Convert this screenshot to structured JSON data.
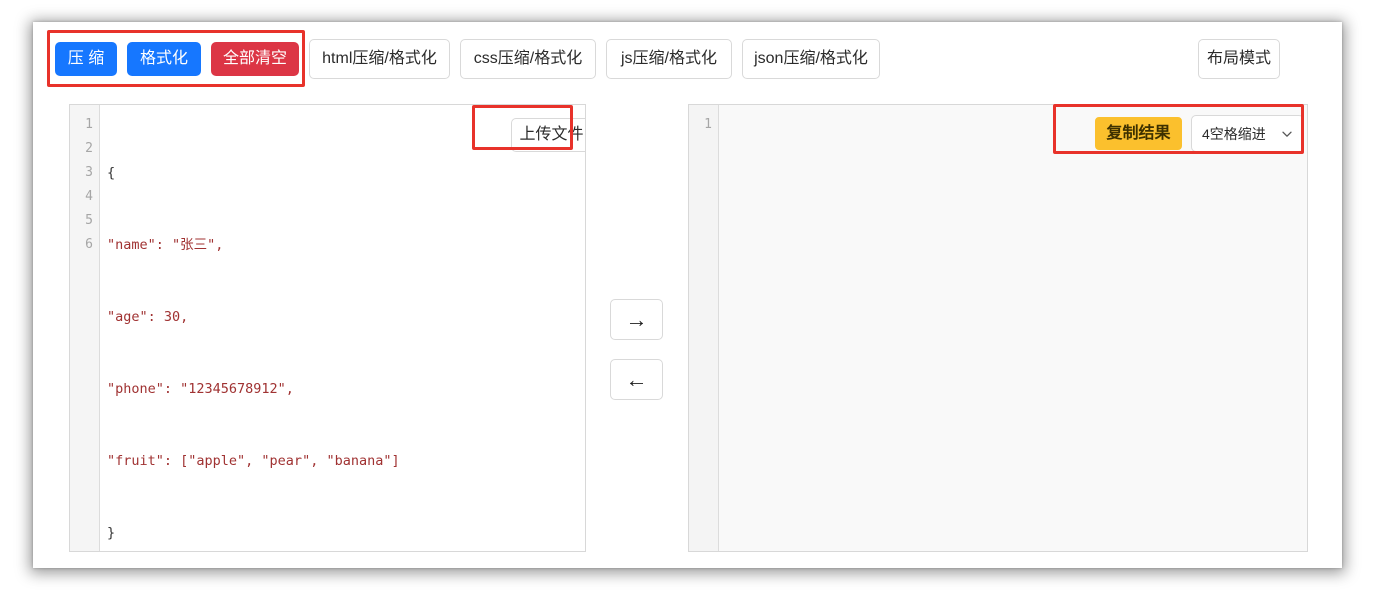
{
  "toolbar": {
    "actions": [
      {
        "label": "压 缩",
        "name": "compress-button",
        "style": "primary"
      },
      {
        "label": "格式化",
        "name": "format-button",
        "style": "primary"
      },
      {
        "label": "全部清空",
        "name": "clear-all-button",
        "style": "danger"
      }
    ],
    "tabs": [
      {
        "label": "html压缩/格式化",
        "name": "tab-html"
      },
      {
        "label": "css压缩/格式化",
        "name": "tab-css"
      },
      {
        "label": "js压缩/格式化",
        "name": "tab-js"
      },
      {
        "label": "json压缩/格式化",
        "name": "tab-json"
      }
    ],
    "layout_mode_label": "布局模式"
  },
  "left_editor": {
    "upload_label": "上传文件",
    "line_numbers": [
      "1",
      "2",
      "3",
      "4",
      "5",
      "6"
    ],
    "lines": [
      "{",
      "\"name\": \"张三\",",
      "\"age\": 30,",
      "\"phone\": \"12345678912\",",
      "\"fruit\": [\"apple\", \"pear\", \"banana\"]",
      "}"
    ]
  },
  "right_editor": {
    "copy_label": "复制结果",
    "indent_value": "4空格缩进",
    "chevron_icon": "chevron-down-icon",
    "line_numbers": [
      "1"
    ],
    "lines": [
      ""
    ]
  },
  "transfer": {
    "to_right_label": "→",
    "to_right_icon": "arrow-right-icon",
    "to_left_label": "←",
    "to_left_icon": "arrow-left-icon"
  },
  "colors": {
    "primary": "#1677ff",
    "danger": "#dc3545",
    "warning": "#fbc02d",
    "annotation": "#e8322a",
    "string_token": "#a03232",
    "number_token": "#1d8a76"
  }
}
